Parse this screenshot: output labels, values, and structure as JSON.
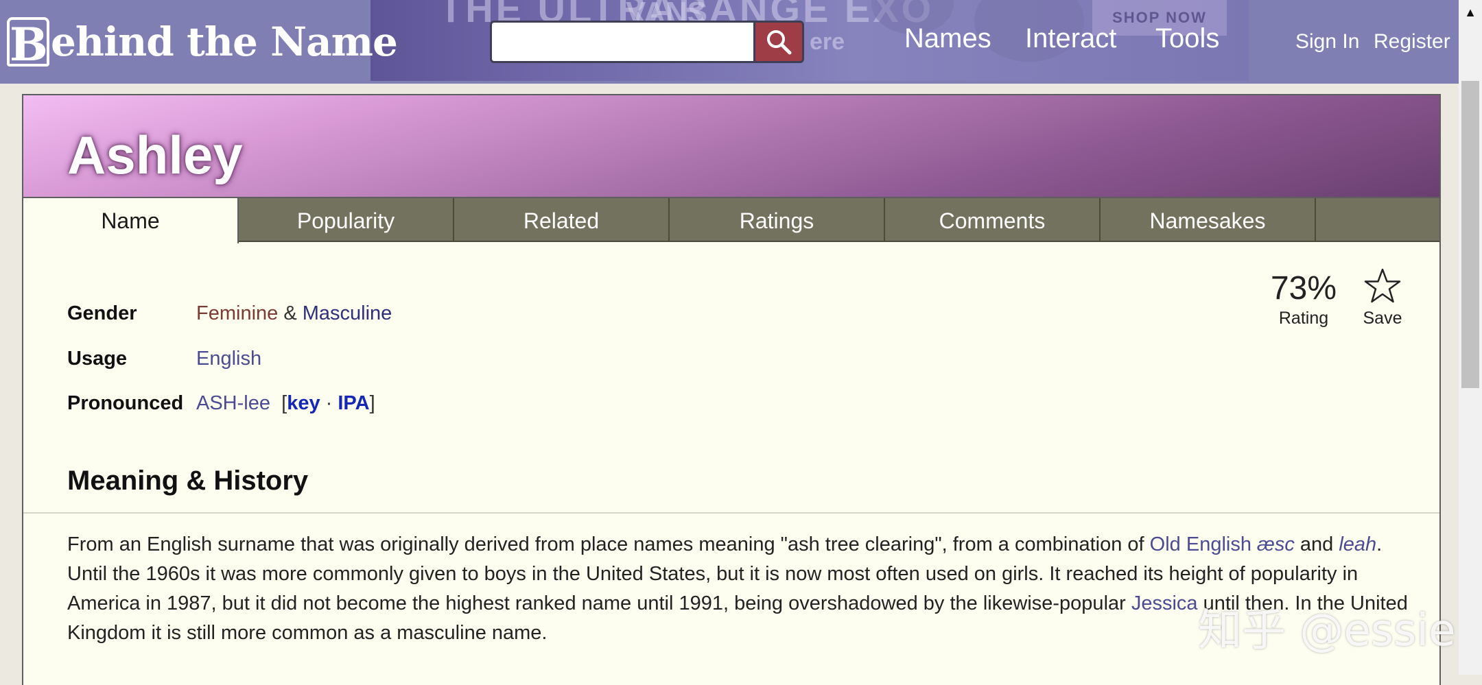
{
  "site": {
    "logo_initial": "B",
    "logo_text": "ehind the Name",
    "search_placeholder": "",
    "nav": [
      "Names",
      "Interact",
      "Tools"
    ],
    "account": {
      "sign_in": "Sign In",
      "register": "Register"
    }
  },
  "banner_ad": {
    "brand": "VANS",
    "headline": "THE ULTRARANGE EXO",
    "partial_text": "ere",
    "cta": "SHOP NOW"
  },
  "name_page": {
    "title": "Ashley",
    "tabs": [
      "Name",
      "Popularity",
      "Related",
      "Ratings",
      "Comments",
      "Namesakes"
    ],
    "active_tab": "Name",
    "info": {
      "gender_label": "Gender",
      "gender_feminine": "Feminine",
      "gender_sep": "&",
      "gender_masculine": "Masculine",
      "usage_label": "Usage",
      "usage_value": "English",
      "pronounced_label": "Pronounced",
      "pronounced_value": "ASH-lee",
      "pron_key": "key",
      "pron_sep": "·",
      "pron_ipa": "IPA"
    },
    "rating": {
      "value": "73%",
      "label": "Rating"
    },
    "save_label": "Save",
    "section_heading": "Meaning & History",
    "history": {
      "p1": "From an English surname that was originally derived from place names meaning \"ash tree clearing\", from a combination of ",
      "link_old_english": "Old English",
      "word_aesc": "æsc",
      "p2": " and ",
      "word_leah": "leah",
      "p3": ". Until the 1960s it was more commonly given to boys in the United States, but it is now most often used on girls. It reached its height of popularity in America in 1987, but it did not become the highest ranked name until 1991, being overshadowed by the likewise-popular ",
      "link_jessica": "Jessica",
      "p4": " until then. In the United Kingdom it is still more common as a masculine name."
    }
  },
  "watermark": "知乎 @essie",
  "colors": {
    "topbar": "#7f7fb4",
    "tabbar": "#73725e",
    "page_bg": "#fdfdf0",
    "search_button": "#9e3d45",
    "feminine": "#7b3a32",
    "masculine": "#2f2f7c",
    "link": "#4b4b93"
  }
}
